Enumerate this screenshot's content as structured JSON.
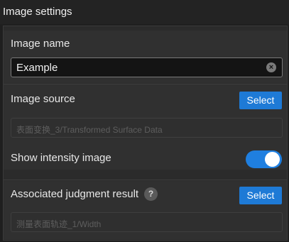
{
  "header": {
    "title": "Image settings"
  },
  "image_name": {
    "label": "Image name",
    "value": "Example"
  },
  "image_source": {
    "label": "Image source",
    "button": "Select",
    "value": "表面变换_3/Transformed Surface Data"
  },
  "intensity": {
    "label": "Show intensity image",
    "enabled": true
  },
  "associated": {
    "label": "Associated judgment result",
    "help": "?",
    "button": "Select",
    "value": "测量表面轨迹_1/Width"
  },
  "colors": {
    "accent": "#1e7ad6",
    "background": "#1f1f1f",
    "panel": "#303030"
  }
}
